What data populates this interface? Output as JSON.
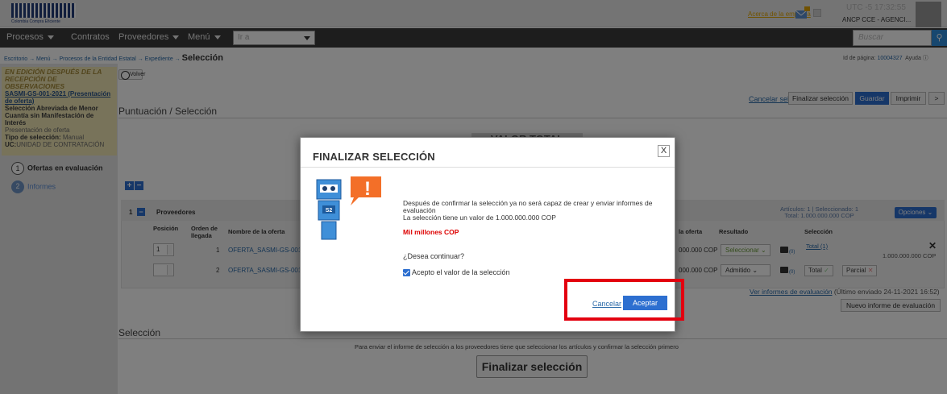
{
  "header": {
    "logo_text": "Colombia Compra Eficiente",
    "top_link": "Acerca de la empresa",
    "utc": "UTC -5 17:32:55",
    "entity": "ANCP CCE - AGENCI..."
  },
  "navbar": {
    "items": [
      "Procesos",
      "Contratos",
      "Proveedores",
      "Menú"
    ],
    "go_to_placeholder": "Ir a",
    "search_placeholder": "Buscar"
  },
  "breadcrumb": {
    "path": "Escritorio → Menú → Procesos de la Entidad Estatal → Expediente →",
    "current": "Selección"
  },
  "page_id": {
    "label": "Id de página:",
    "value": "10004327",
    "help": "Ayuda"
  },
  "sidebar": {
    "status": "EN EDICIÓN DESPUÉS DE LA RECEPCIÓN DE OBSERVACIONES",
    "process_code": "SASMI-GS-001-2021 (Presentación de oferta)",
    "process_name": "Selección Abreviada de Menor Cuantía sin Manifestación de Interés",
    "phase": "Presentación de oferta",
    "selection_type_label": "Tipo de selección:",
    "selection_type": "Manual",
    "uc_label": "UC:",
    "uc": "UNIDAD DE CONTRATACIÓN",
    "steps": [
      {
        "num": "1",
        "label": "Ofertas en evaluación"
      },
      {
        "num": "2",
        "label": "Informes"
      }
    ]
  },
  "toolbar": {
    "volver": "Volver",
    "cancelar": "Cancelar selección",
    "finalizar": "Finalizar selección",
    "guardar": "Guardar",
    "imprimir": "Imprimir",
    "more": ">"
  },
  "section_puntuacion": "Puntuación / Selección",
  "valor_total": "VALOR TOTAL",
  "table": {
    "group_num": "1",
    "group_label": "Proveedores",
    "articles_info": "Artículos: 1  |  Seleccionado: 1",
    "total_info": "Total: 1.000.000.000 COP",
    "opciones": "Opciones",
    "columns": [
      "Posición",
      "Orden de llegada",
      "Nombre de la oferta",
      "la oferta",
      "Resultado",
      "Selección"
    ],
    "rows": [
      {
        "posicion": "1",
        "orden": "1",
        "nombre": "OFERTA_SASMI-GS-001",
        "valor": "000.000 COP",
        "resultado": "Seleccionar",
        "comments": "(0)",
        "seleccion": "Total (1)",
        "right_value": "1.000.000.000 COP"
      },
      {
        "posicion": "",
        "orden": "2",
        "nombre": "OFERTA_SASMI-GS-001",
        "valor": "000.000 COP",
        "resultado": "Admitido",
        "comments": "(0)",
        "total_btn": "Total",
        "parcial_btn": "Parcial"
      }
    ]
  },
  "ver_informes": {
    "link": "Ver informes de evaluación",
    "suffix": "(Último enviado 24-11-2021 16:52)"
  },
  "nuevo_informe": "Nuevo informe de evaluación",
  "section_seleccion": "Selección",
  "seleccion_info": "Para enviar el informe de selección a los proveedores tiene que seleccionar los artículos y confirmar la selección primero",
  "finalizar_seleccion_btn": "Finalizar selección",
  "modal": {
    "title": "FINALIZAR SELECCIÓN",
    "close": "X",
    "message_1": "Después de confirmar la selección ya no será capaz de crear y enviar informes de evaluación",
    "message_2": "La selección tiene un valor de 1.000.000.000 COP",
    "amount_words": "Mil millones COP",
    "question": "¿Desea continuar?",
    "checkbox_label": "Acepto el valor de la selección",
    "cancel": "Cancelar",
    "accept": "Aceptar",
    "robot_badge": "S2",
    "robot_alert": "!"
  },
  "colors": {
    "accent": "#2d6fd0",
    "highlight": "#e3000f",
    "status_bg": "#f1e7b5"
  }
}
